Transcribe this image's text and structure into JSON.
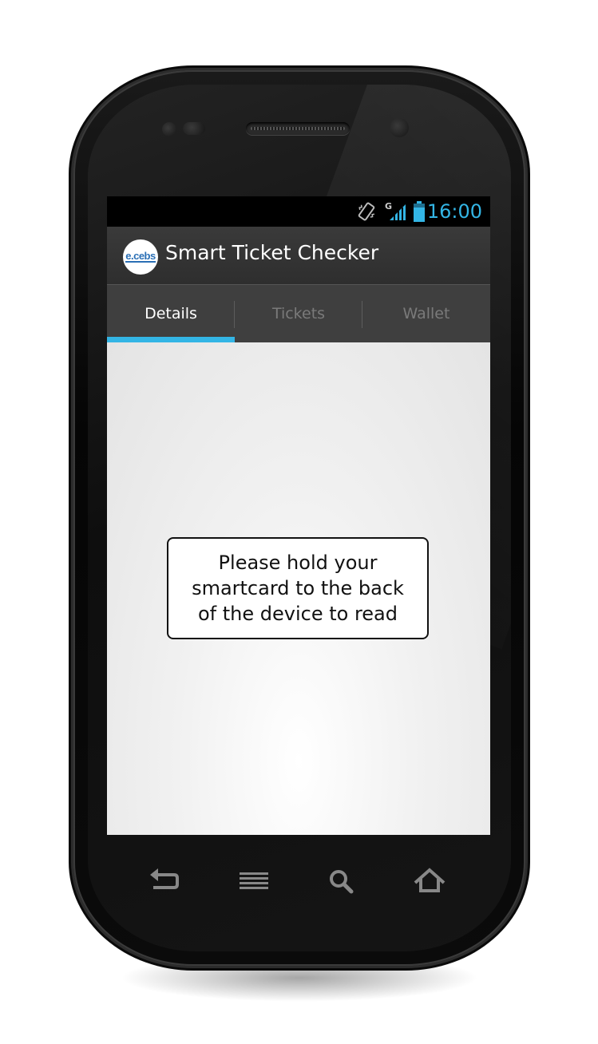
{
  "status_bar": {
    "time": "16:00",
    "icons": [
      "vibrate-icon",
      "signal-icon",
      "battery-icon"
    ],
    "network_label": "G"
  },
  "action_bar": {
    "logo_text": "e.cebs",
    "title": "Smart Ticket Checker"
  },
  "tabs": [
    {
      "label": "Details",
      "active": true
    },
    {
      "label": "Tickets",
      "active": false
    },
    {
      "label": "Wallet",
      "active": false
    }
  ],
  "content": {
    "message": "Please hold your smartcard to the back of the device to read"
  },
  "nav_buttons": [
    "back-icon",
    "menu-icon",
    "search-icon",
    "home-icon"
  ],
  "colors": {
    "accent": "#33b5e5",
    "action_bar": "#333333",
    "tab_bar": "#3f3f3f"
  }
}
